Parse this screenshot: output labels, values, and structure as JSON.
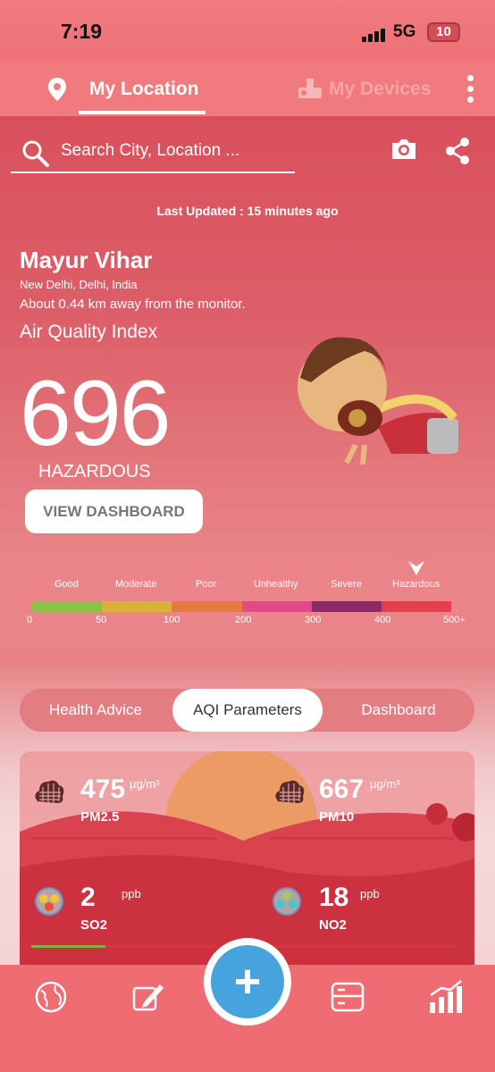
{
  "status_bar": {
    "time": "7:19",
    "network": "5G",
    "battery": "10"
  },
  "tabs": {
    "my_location": "My Location",
    "my_devices": "My Devices"
  },
  "search": {
    "placeholder": "Search City, Location ..."
  },
  "last_updated": "Last Updated : 15 minutes ago",
  "location": {
    "name": "Mayur Vihar",
    "region": "New Delhi, Delhi, India",
    "distance": "About 0.44 km away from the monitor."
  },
  "aqi": {
    "label": "Air Quality Index",
    "value": "696",
    "status": "HAZARDOUS"
  },
  "view_dashboard": "VIEW DASHBOARD",
  "scale": {
    "categories": [
      "Good",
      "Moderate",
      "Poor",
      "Unhealthy",
      "Severe",
      "Hazardous"
    ],
    "ticks": [
      "0",
      "50",
      "100",
      "200",
      "300",
      "400",
      "500+"
    ],
    "colors": [
      "#8dc04a",
      "#d9b23c",
      "#e57940",
      "#e04a8a",
      "#8b2a6b",
      "#e3404e"
    ]
  },
  "segment_tabs": [
    "Health Advice",
    "AQI Parameters",
    "Dashboard"
  ],
  "parameters": [
    {
      "name": "PM2.5",
      "value": "475",
      "unit": "µg/m³"
    },
    {
      "name": "PM10",
      "value": "667",
      "unit": "µg/m³"
    },
    {
      "name": "SO2",
      "value": "2",
      "unit": "ppb"
    },
    {
      "name": "NO2",
      "value": "18",
      "unit": "ppb"
    }
  ],
  "bottom_nav": [
    "globe-icon",
    "edit-icon",
    "add-icon",
    "card-icon",
    "stats-icon"
  ]
}
